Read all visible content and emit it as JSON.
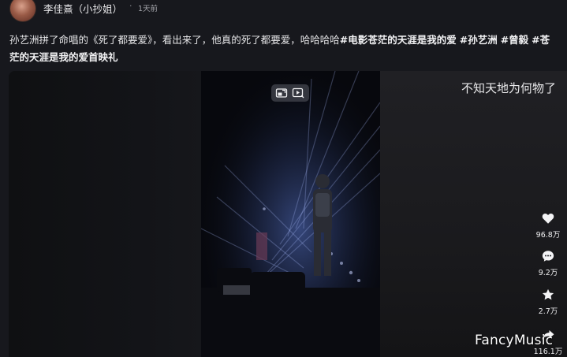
{
  "header": {
    "author_name": "李佳熹（小抄姐）",
    "separator": "·",
    "post_time": "1天前"
  },
  "description": {
    "line1": "孙艺洲拼了命唱的《死了都要爱》，看出来了，他真的死了都要爱，哈哈哈哈",
    "tags_line1": [
      "#电影苍茫的天涯是我的爱",
      "#孙艺洲",
      "#曾毅",
      "#苍"
    ],
    "line2": "茫的天涯是我的爱首映礼"
  },
  "video": {
    "overlay_title": "不知天地为何物了",
    "controls": {
      "pip_icon": "picture-in-picture-icon",
      "fullscreen_icon": "play-window-icon"
    },
    "watermark": "FancyMusic"
  },
  "actions": {
    "like": {
      "icon": "heart-icon",
      "count": "96.8万"
    },
    "comment": {
      "icon": "comment-icon",
      "count": "9.2万"
    },
    "favorite": {
      "icon": "star-icon",
      "count": "2.7万"
    },
    "share": {
      "icon": "share-icon",
      "count": "116.1万"
    }
  },
  "colors": {
    "background": "#17181d",
    "text": "#e6e6e8",
    "muted": "#a4a5ab",
    "stage_blue": "#26324f"
  }
}
